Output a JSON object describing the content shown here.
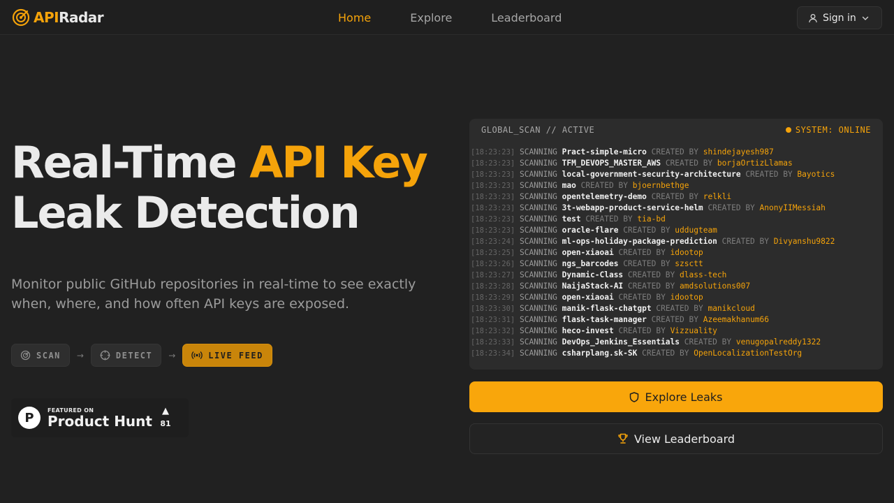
{
  "brand": {
    "part1": "API",
    "part2": "Radar"
  },
  "nav": {
    "home": "Home",
    "explore": "Explore",
    "leaderboard": "Leaderboard"
  },
  "auth": {
    "signin_label": "Sign in"
  },
  "hero": {
    "title_part1": "Real-Time ",
    "title_accent": "API Key",
    "title_line2": "Leak Detection",
    "subtitle": "Monitor public GitHub repositories in real-time to see exactly when, where, and how often API keys are exposed."
  },
  "steps": {
    "scan": "SCAN",
    "detect": "DETECT",
    "live": "LIVE FEED"
  },
  "product_hunt": {
    "featured": "FEATURED ON",
    "name": "Product Hunt",
    "votes": "81"
  },
  "terminal": {
    "title": "GLOBAL_SCAN // ACTIVE",
    "status": "SYSTEM: ONLINE",
    "scan_word": "SCANNING",
    "created_word": "CREATED BY",
    "rows": [
      {
        "ts": "[18:23:23]",
        "repo": "Pract-simple-micro",
        "user": "shindejayesh987"
      },
      {
        "ts": "[18:23:23]",
        "repo": "TFM_DEVOPS_MASTER_AWS",
        "user": "borjaOrtizLlamas"
      },
      {
        "ts": "[18:23:23]",
        "repo": "local-government-security-architecture",
        "user": "Bayotics"
      },
      {
        "ts": "[18:23:23]",
        "repo": "mao",
        "user": "bjoernbethge"
      },
      {
        "ts": "[18:23:23]",
        "repo": "opentelemetry-demo",
        "user": "relkli"
      },
      {
        "ts": "[18:23:23]",
        "repo": "3t-webapp-product-service-helm",
        "user": "AnonyIIMessiah"
      },
      {
        "ts": "[18:23:23]",
        "repo": "test",
        "user": "tia-bd"
      },
      {
        "ts": "[18:23:23]",
        "repo": "oracle-flare",
        "user": "uddugteam"
      },
      {
        "ts": "[18:23:24]",
        "repo": "ml-ops-holiday-package-prediction",
        "user": "Divyanshu9822"
      },
      {
        "ts": "[18:23:25]",
        "repo": "open-xiaoai",
        "user": "idootop"
      },
      {
        "ts": "[18:23:26]",
        "repo": "ngs_barcodes",
        "user": "szsctt"
      },
      {
        "ts": "[18:23:27]",
        "repo": "Dynamic-Class",
        "user": "dlass-tech"
      },
      {
        "ts": "[18:23:28]",
        "repo": "NaijaStack-AI",
        "user": "amdsolutions007"
      },
      {
        "ts": "[18:23:29]",
        "repo": "open-xiaoai",
        "user": "idootop"
      },
      {
        "ts": "[18:23:30]",
        "repo": "manik-flask-chatgpt",
        "user": "manikcloud"
      },
      {
        "ts": "[18:23:31]",
        "repo": "flask-task-manager",
        "user": "Azeemakhanum66"
      },
      {
        "ts": "[18:23:32]",
        "repo": "heco-invest",
        "user": "Vizzuality"
      },
      {
        "ts": "[18:23:33]",
        "repo": "DevOps_Jenkins_Essentials",
        "user": "venugopalreddy1322"
      },
      {
        "ts": "[18:23:34]",
        "repo": "csharplang.sk-SK",
        "user": "OpenLocalizationTestOrg"
      }
    ]
  },
  "actions": {
    "explore_leaks": "Explore Leaks",
    "view_leaderboard": "View Leaderboard"
  },
  "colors": {
    "accent": "#f5a30a",
    "background": "#212121"
  },
  "icons": {
    "logo": "radar-icon",
    "signin": "user-icon",
    "chevron": "chevron-down-icon",
    "scan": "scan-icon",
    "detect": "crosshair-icon",
    "live": "broadcast-icon",
    "explore": "shield-icon",
    "leaderboard": "trophy-icon"
  }
}
